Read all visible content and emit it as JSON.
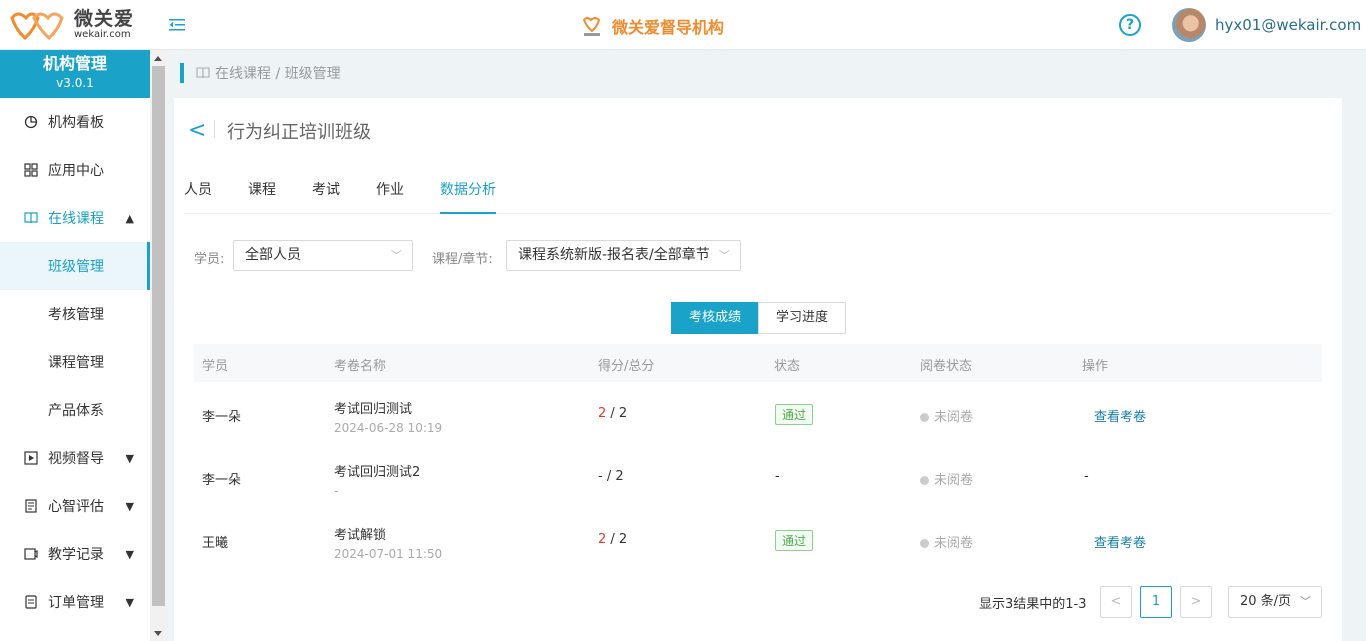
{
  "header": {
    "logo_cn": "微关爱",
    "logo_en": "wekair.com",
    "brand_title": "微关爱督导机构",
    "brand_mini": "微关爱",
    "help_icon": "?",
    "user_email": "hyx01@wekair.com"
  },
  "sidebar": {
    "title": "机构管理",
    "version": "v3.0.1",
    "items": [
      {
        "label": "机构看板",
        "icon": "dashboard-icon"
      },
      {
        "label": "应用中心",
        "icon": "apps-icon"
      },
      {
        "label": "在线课程",
        "icon": "book-icon",
        "chevron": "▲"
      },
      {
        "label": "班级管理"
      },
      {
        "label": "考核管理"
      },
      {
        "label": "课程管理"
      },
      {
        "label": "产品体系"
      },
      {
        "label": "视频督导",
        "icon": "video-icon",
        "chevron": "▼"
      },
      {
        "label": "心智评估",
        "icon": "assessment-icon",
        "chevron": "▼"
      },
      {
        "label": "教学记录",
        "icon": "record-icon",
        "chevron": "▼"
      },
      {
        "label": "订单管理",
        "icon": "order-icon",
        "chevron": "▼"
      }
    ]
  },
  "breadcrumb": "在线课程 / 班级管理",
  "page": {
    "back": "<",
    "title": "行为纠正培训班级",
    "tabs": [
      "人员",
      "课程",
      "考试",
      "作业",
      "数据分析"
    ]
  },
  "filters": {
    "student_label": "学员:",
    "student_value": "全部人员",
    "course_label": "课程/章节:",
    "course_value": "课程系统新版-报名表/全部章节",
    "arrow": "﹀"
  },
  "segments": [
    "考核成绩",
    "学习进度"
  ],
  "table": {
    "headers": [
      "学员",
      "考卷名称",
      "得分/总分",
      "状态",
      "阅卷状态",
      "操作"
    ],
    "rows": [
      {
        "student": "李一朵",
        "paper": "考试回归测试",
        "time": "2024-06-28 10:19",
        "score": "2",
        "total": " / 2",
        "status": "通过",
        "review": "未阅卷",
        "action": "查看考卷"
      },
      {
        "student": "李一朵",
        "paper": "考试回归测试2",
        "time": "-",
        "score": "-",
        "total": " / 2",
        "status": "-",
        "review": "未阅卷",
        "action": "-"
      },
      {
        "student": "王曦",
        "paper": "考试解锁",
        "time": "2024-07-01 11:50",
        "score": "2",
        "total": " / 2",
        "status": "通过",
        "review": "未阅卷",
        "action": "查看考卷"
      }
    ]
  },
  "pagination": {
    "info": "显示3结果中的1-3",
    "prev": "<",
    "current": "1",
    "next": ">",
    "page_size": "20 条/页",
    "size_arrow": "﹀"
  },
  "colors": {
    "accent": "#1aa2c8",
    "brand": "#f08c2e",
    "score": "#e53935",
    "pass": "#52a852"
  }
}
